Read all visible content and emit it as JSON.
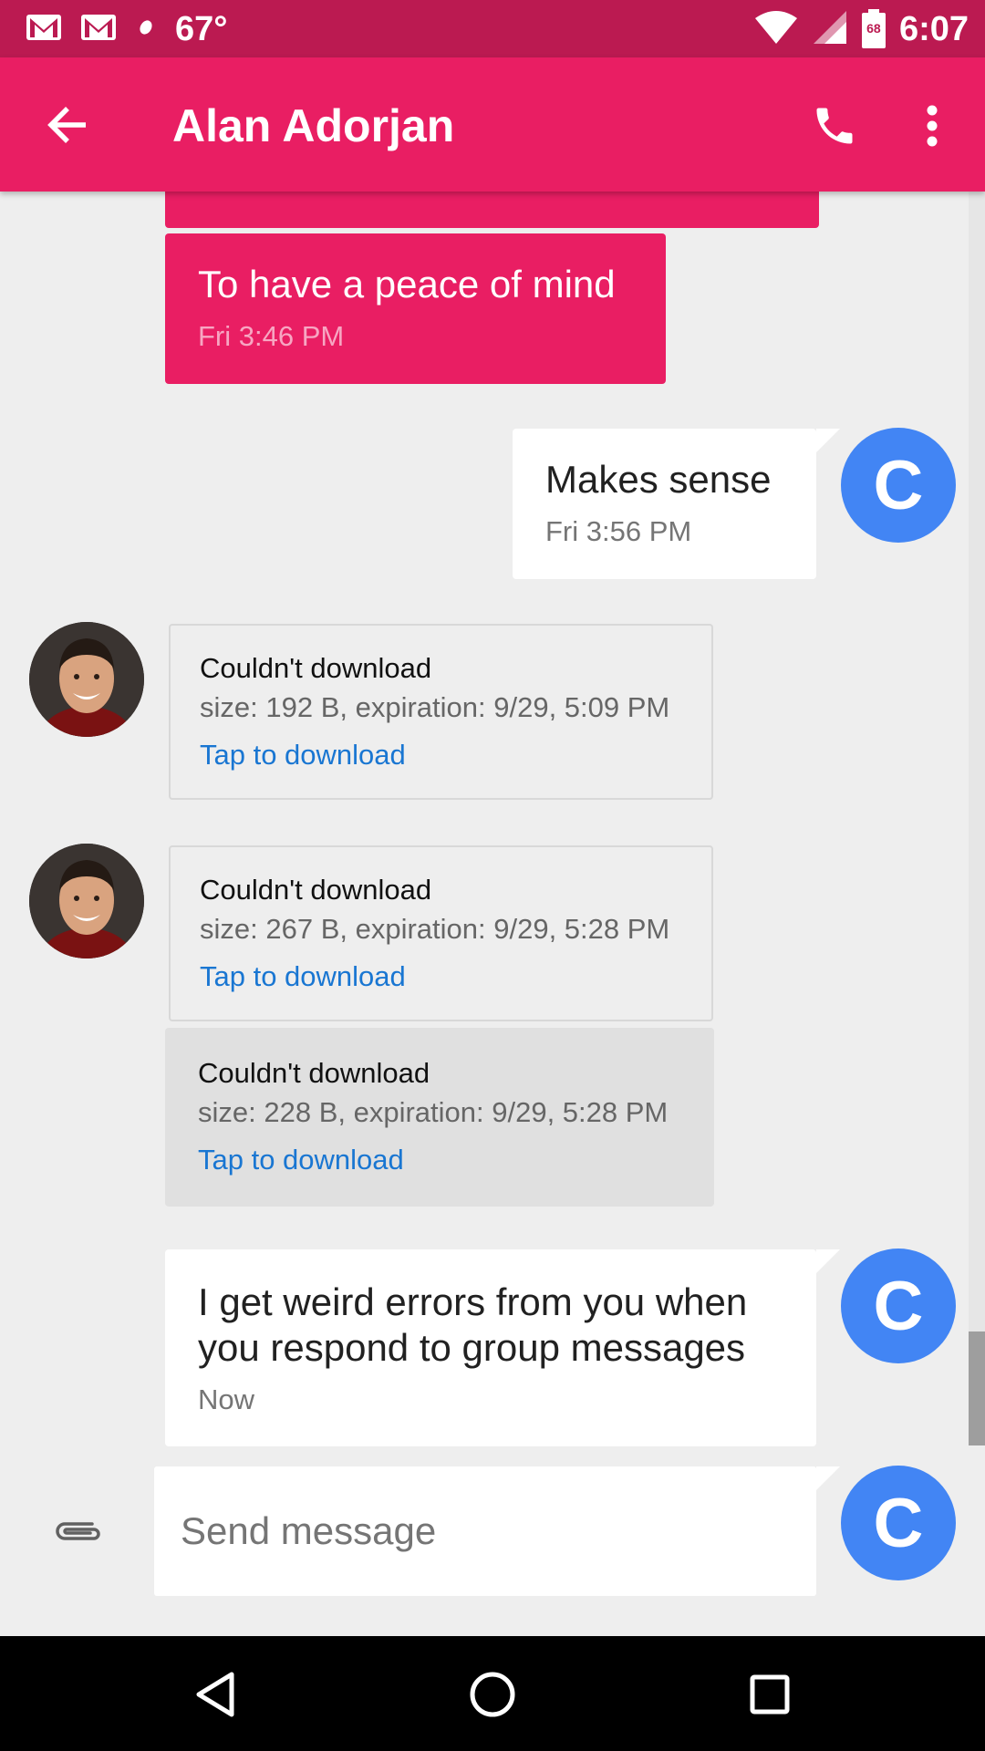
{
  "status_bar": {
    "temperature": "67°",
    "battery_level": "68",
    "time": "6:07"
  },
  "toolbar": {
    "title": "Alan Adorjan"
  },
  "avatar_letter": "C",
  "messages": {
    "incoming_1": {
      "text": "To have a peace of mind",
      "time": "Fri 3:46 PM"
    },
    "outgoing_1": {
      "text": "Makes sense",
      "time": "Fri 3:56 PM"
    },
    "mms_1": {
      "title": "Couldn't download",
      "meta": "size: 192 B, expiration: 9/29, 5:09 PM",
      "action": "Tap to download"
    },
    "mms_2": {
      "title": "Couldn't download",
      "meta": "size: 267 B, expiration: 9/29, 5:28 PM",
      "action": "Tap to download"
    },
    "mms_3": {
      "title": "Couldn't download",
      "meta": "size: 228 B, expiration: 9/29, 5:28 PM",
      "action": "Tap to download"
    },
    "outgoing_2": {
      "text": "I get weird errors from you when you respond to group messages",
      "time": "Now"
    }
  },
  "compose": {
    "placeholder": "Send message"
  },
  "colors": {
    "primary": "#e91e63",
    "primary_dark": "#bb1a51",
    "avatar": "#4285f4",
    "link": "#1976d2"
  }
}
